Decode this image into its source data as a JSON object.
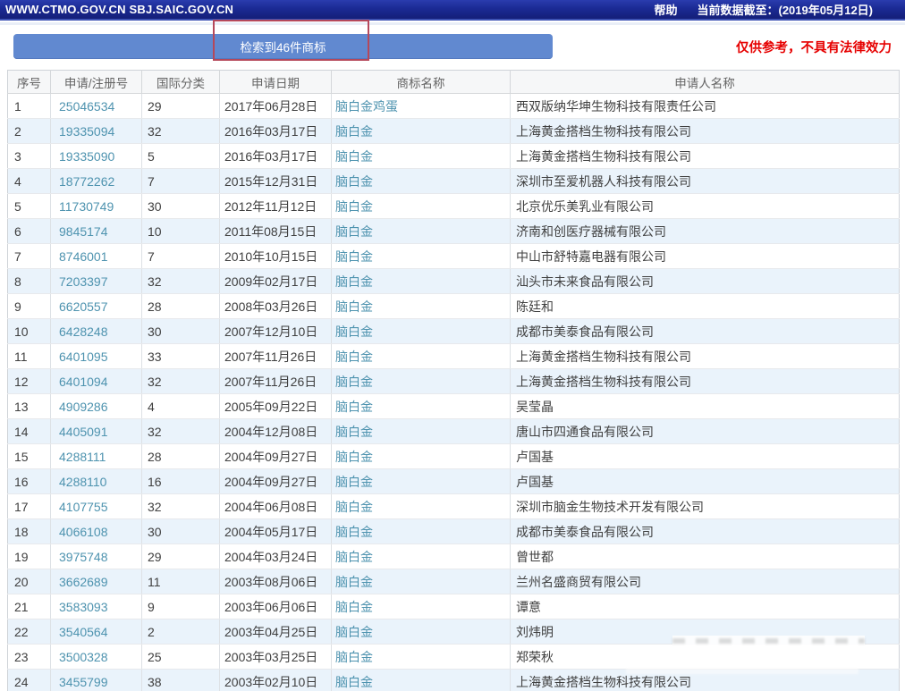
{
  "topbar": {
    "site_title": "WWW.CTMO.GOV.CN SBJ.SAIC.GOV.CN",
    "help_label": "帮助",
    "data_cutoff": "当前数据截至：(2019年05月12日)"
  },
  "banner": {
    "result_count_label": "检索到46件商标",
    "disclaimer": "仅供参考，不具有法律效力"
  },
  "colors": {
    "topbar_bg": "#1b2a94",
    "banner_button_bg": "#6189d0",
    "annotation_red": "#b5485a",
    "disclaimer_red": "#e60000",
    "link_teal": "#4e93af",
    "even_row_bg": "#eaf3fb"
  },
  "table": {
    "headers": [
      "序号",
      "申请/注册号",
      "国际分类",
      "申请日期",
      "商标名称",
      "申请人名称"
    ],
    "rows": [
      [
        "1",
        "25046534",
        "29",
        "2017年06月28日",
        "脑白金鸡蛋",
        "西双版纳华坤生物科技有限责任公司"
      ],
      [
        "2",
        "19335094",
        "32",
        "2016年03月17日",
        "脑白金",
        "上海黄金搭档生物科技有限公司"
      ],
      [
        "3",
        "19335090",
        "5",
        "2016年03月17日",
        "脑白金",
        "上海黄金搭档生物科技有限公司"
      ],
      [
        "4",
        "18772262",
        "7",
        "2015年12月31日",
        "脑白金",
        "深圳市至爱机器人科技有限公司"
      ],
      [
        "5",
        "11730749",
        "30",
        "2012年11月12日",
        "脑白金",
        "北京优乐美乳业有限公司"
      ],
      [
        "6",
        "9845174",
        "10",
        "2011年08月15日",
        "脑白金",
        "济南和创医疗器械有限公司"
      ],
      [
        "7",
        "8746001",
        "7",
        "2010年10月15日",
        "脑白金",
        "中山市舒特嘉电器有限公司"
      ],
      [
        "8",
        "7203397",
        "32",
        "2009年02月17日",
        "脑白金",
        "汕头市未来食品有限公司"
      ],
      [
        "9",
        "6620557",
        "28",
        "2008年03月26日",
        "脑白金",
        "陈廷和"
      ],
      [
        "10",
        "6428248",
        "30",
        "2007年12月10日",
        "脑白金",
        "成都市美泰食品有限公司"
      ],
      [
        "11",
        "6401095",
        "33",
        "2007年11月26日",
        "脑白金",
        "上海黄金搭档生物科技有限公司"
      ],
      [
        "12",
        "6401094",
        "32",
        "2007年11月26日",
        "脑白金",
        "上海黄金搭档生物科技有限公司"
      ],
      [
        "13",
        "4909286",
        "4",
        "2005年09月22日",
        "脑白金",
        "吴莹晶"
      ],
      [
        "14",
        "4405091",
        "32",
        "2004年12月08日",
        "脑白金",
        "唐山市四通食品有限公司"
      ],
      [
        "15",
        "4288111",
        "28",
        "2004年09月27日",
        "脑白金",
        "卢国基"
      ],
      [
        "16",
        "4288110",
        "16",
        "2004年09月27日",
        "脑白金",
        "卢国基"
      ],
      [
        "17",
        "4107755",
        "32",
        "2004年06月08日",
        "脑白金",
        "深圳市脑金生物技术开发有限公司"
      ],
      [
        "18",
        "4066108",
        "30",
        "2004年05月17日",
        "脑白金",
        "成都市美泰食品有限公司"
      ],
      [
        "19",
        "3975748",
        "29",
        "2004年03月24日",
        "脑白金",
        "曾世都"
      ],
      [
        "20",
        "3662689",
        "11",
        "2003年08月06日",
        "脑白金",
        "兰州名盛商贸有限公司"
      ],
      [
        "21",
        "3583093",
        "9",
        "2003年06月06日",
        "脑白金",
        "谭意"
      ],
      [
        "22",
        "3540564",
        "2",
        "2003年04月25日",
        "脑白金",
        "刘炜明"
      ],
      [
        "23",
        "3500328",
        "25",
        "2003年03月25日",
        "脑白金",
        "郑荣秋"
      ],
      [
        "24",
        "3455799",
        "38",
        "2003年02月10日",
        "脑白金",
        "上海黄金搭档生物科技有限公司"
      ]
    ]
  }
}
